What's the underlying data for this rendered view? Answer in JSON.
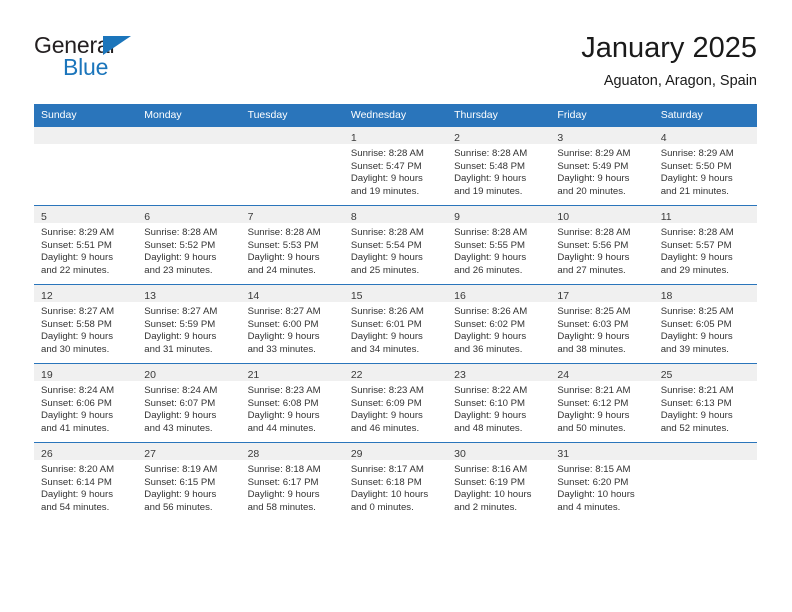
{
  "brand": {
    "name_top": "General",
    "name_bottom": "Blue",
    "accent_color": "#1b75bb"
  },
  "header": {
    "title": "January 2025",
    "subtitle": "Aguaton, Aragon, Spain"
  },
  "theme": {
    "header_bg": "#2a75bb",
    "daynum_bg": "#f0f0f0",
    "grid_line": "#2a75bb"
  },
  "weekday_headers": [
    "Sunday",
    "Monday",
    "Tuesday",
    "Wednesday",
    "Thursday",
    "Friday",
    "Saturday"
  ],
  "weeks": [
    [
      {
        "day": "",
        "empty": true,
        "lines": [
          "",
          "",
          "",
          ""
        ]
      },
      {
        "day": "",
        "empty": true,
        "lines": [
          "",
          "",
          "",
          ""
        ]
      },
      {
        "day": "",
        "empty": true,
        "lines": [
          "",
          "",
          "",
          ""
        ]
      },
      {
        "day": "1",
        "empty": false,
        "lines": [
          "Sunrise: 8:28 AM",
          "Sunset: 5:47 PM",
          "Daylight: 9 hours",
          "and 19 minutes."
        ]
      },
      {
        "day": "2",
        "empty": false,
        "lines": [
          "Sunrise: 8:28 AM",
          "Sunset: 5:48 PM",
          "Daylight: 9 hours",
          "and 19 minutes."
        ]
      },
      {
        "day": "3",
        "empty": false,
        "lines": [
          "Sunrise: 8:29 AM",
          "Sunset: 5:49 PM",
          "Daylight: 9 hours",
          "and 20 minutes."
        ]
      },
      {
        "day": "4",
        "empty": false,
        "lines": [
          "Sunrise: 8:29 AM",
          "Sunset: 5:50 PM",
          "Daylight: 9 hours",
          "and 21 minutes."
        ]
      }
    ],
    [
      {
        "day": "5",
        "empty": false,
        "lines": [
          "Sunrise: 8:29 AM",
          "Sunset: 5:51 PM",
          "Daylight: 9 hours",
          "and 22 minutes."
        ]
      },
      {
        "day": "6",
        "empty": false,
        "lines": [
          "Sunrise: 8:28 AM",
          "Sunset: 5:52 PM",
          "Daylight: 9 hours",
          "and 23 minutes."
        ]
      },
      {
        "day": "7",
        "empty": false,
        "lines": [
          "Sunrise: 8:28 AM",
          "Sunset: 5:53 PM",
          "Daylight: 9 hours",
          "and 24 minutes."
        ]
      },
      {
        "day": "8",
        "empty": false,
        "lines": [
          "Sunrise: 8:28 AM",
          "Sunset: 5:54 PM",
          "Daylight: 9 hours",
          "and 25 minutes."
        ]
      },
      {
        "day": "9",
        "empty": false,
        "lines": [
          "Sunrise: 8:28 AM",
          "Sunset: 5:55 PM",
          "Daylight: 9 hours",
          "and 26 minutes."
        ]
      },
      {
        "day": "10",
        "empty": false,
        "lines": [
          "Sunrise: 8:28 AM",
          "Sunset: 5:56 PM",
          "Daylight: 9 hours",
          "and 27 minutes."
        ]
      },
      {
        "day": "11",
        "empty": false,
        "lines": [
          "Sunrise: 8:28 AM",
          "Sunset: 5:57 PM",
          "Daylight: 9 hours",
          "and 29 minutes."
        ]
      }
    ],
    [
      {
        "day": "12",
        "empty": false,
        "lines": [
          "Sunrise: 8:27 AM",
          "Sunset: 5:58 PM",
          "Daylight: 9 hours",
          "and 30 minutes."
        ]
      },
      {
        "day": "13",
        "empty": false,
        "lines": [
          "Sunrise: 8:27 AM",
          "Sunset: 5:59 PM",
          "Daylight: 9 hours",
          "and 31 minutes."
        ]
      },
      {
        "day": "14",
        "empty": false,
        "lines": [
          "Sunrise: 8:27 AM",
          "Sunset: 6:00 PM",
          "Daylight: 9 hours",
          "and 33 minutes."
        ]
      },
      {
        "day": "15",
        "empty": false,
        "lines": [
          "Sunrise: 8:26 AM",
          "Sunset: 6:01 PM",
          "Daylight: 9 hours",
          "and 34 minutes."
        ]
      },
      {
        "day": "16",
        "empty": false,
        "lines": [
          "Sunrise: 8:26 AM",
          "Sunset: 6:02 PM",
          "Daylight: 9 hours",
          "and 36 minutes."
        ]
      },
      {
        "day": "17",
        "empty": false,
        "lines": [
          "Sunrise: 8:25 AM",
          "Sunset: 6:03 PM",
          "Daylight: 9 hours",
          "and 38 minutes."
        ]
      },
      {
        "day": "18",
        "empty": false,
        "lines": [
          "Sunrise: 8:25 AM",
          "Sunset: 6:05 PM",
          "Daylight: 9 hours",
          "and 39 minutes."
        ]
      }
    ],
    [
      {
        "day": "19",
        "empty": false,
        "lines": [
          "Sunrise: 8:24 AM",
          "Sunset: 6:06 PM",
          "Daylight: 9 hours",
          "and 41 minutes."
        ]
      },
      {
        "day": "20",
        "empty": false,
        "lines": [
          "Sunrise: 8:24 AM",
          "Sunset: 6:07 PM",
          "Daylight: 9 hours",
          "and 43 minutes."
        ]
      },
      {
        "day": "21",
        "empty": false,
        "lines": [
          "Sunrise: 8:23 AM",
          "Sunset: 6:08 PM",
          "Daylight: 9 hours",
          "and 44 minutes."
        ]
      },
      {
        "day": "22",
        "empty": false,
        "lines": [
          "Sunrise: 8:23 AM",
          "Sunset: 6:09 PM",
          "Daylight: 9 hours",
          "and 46 minutes."
        ]
      },
      {
        "day": "23",
        "empty": false,
        "lines": [
          "Sunrise: 8:22 AM",
          "Sunset: 6:10 PM",
          "Daylight: 9 hours",
          "and 48 minutes."
        ]
      },
      {
        "day": "24",
        "empty": false,
        "lines": [
          "Sunrise: 8:21 AM",
          "Sunset: 6:12 PM",
          "Daylight: 9 hours",
          "and 50 minutes."
        ]
      },
      {
        "day": "25",
        "empty": false,
        "lines": [
          "Sunrise: 8:21 AM",
          "Sunset: 6:13 PM",
          "Daylight: 9 hours",
          "and 52 minutes."
        ]
      }
    ],
    [
      {
        "day": "26",
        "empty": false,
        "lines": [
          "Sunrise: 8:20 AM",
          "Sunset: 6:14 PM",
          "Daylight: 9 hours",
          "and 54 minutes."
        ]
      },
      {
        "day": "27",
        "empty": false,
        "lines": [
          "Sunrise: 8:19 AM",
          "Sunset: 6:15 PM",
          "Daylight: 9 hours",
          "and 56 minutes."
        ]
      },
      {
        "day": "28",
        "empty": false,
        "lines": [
          "Sunrise: 8:18 AM",
          "Sunset: 6:17 PM",
          "Daylight: 9 hours",
          "and 58 minutes."
        ]
      },
      {
        "day": "29",
        "empty": false,
        "lines": [
          "Sunrise: 8:17 AM",
          "Sunset: 6:18 PM",
          "Daylight: 10 hours",
          "and 0 minutes."
        ]
      },
      {
        "day": "30",
        "empty": false,
        "lines": [
          "Sunrise: 8:16 AM",
          "Sunset: 6:19 PM",
          "Daylight: 10 hours",
          "and 2 minutes."
        ]
      },
      {
        "day": "31",
        "empty": false,
        "lines": [
          "Sunrise: 8:15 AM",
          "Sunset: 6:20 PM",
          "Daylight: 10 hours",
          "and 4 minutes."
        ]
      },
      {
        "day": "",
        "empty": true,
        "lines": [
          "",
          "",
          "",
          ""
        ]
      }
    ]
  ]
}
